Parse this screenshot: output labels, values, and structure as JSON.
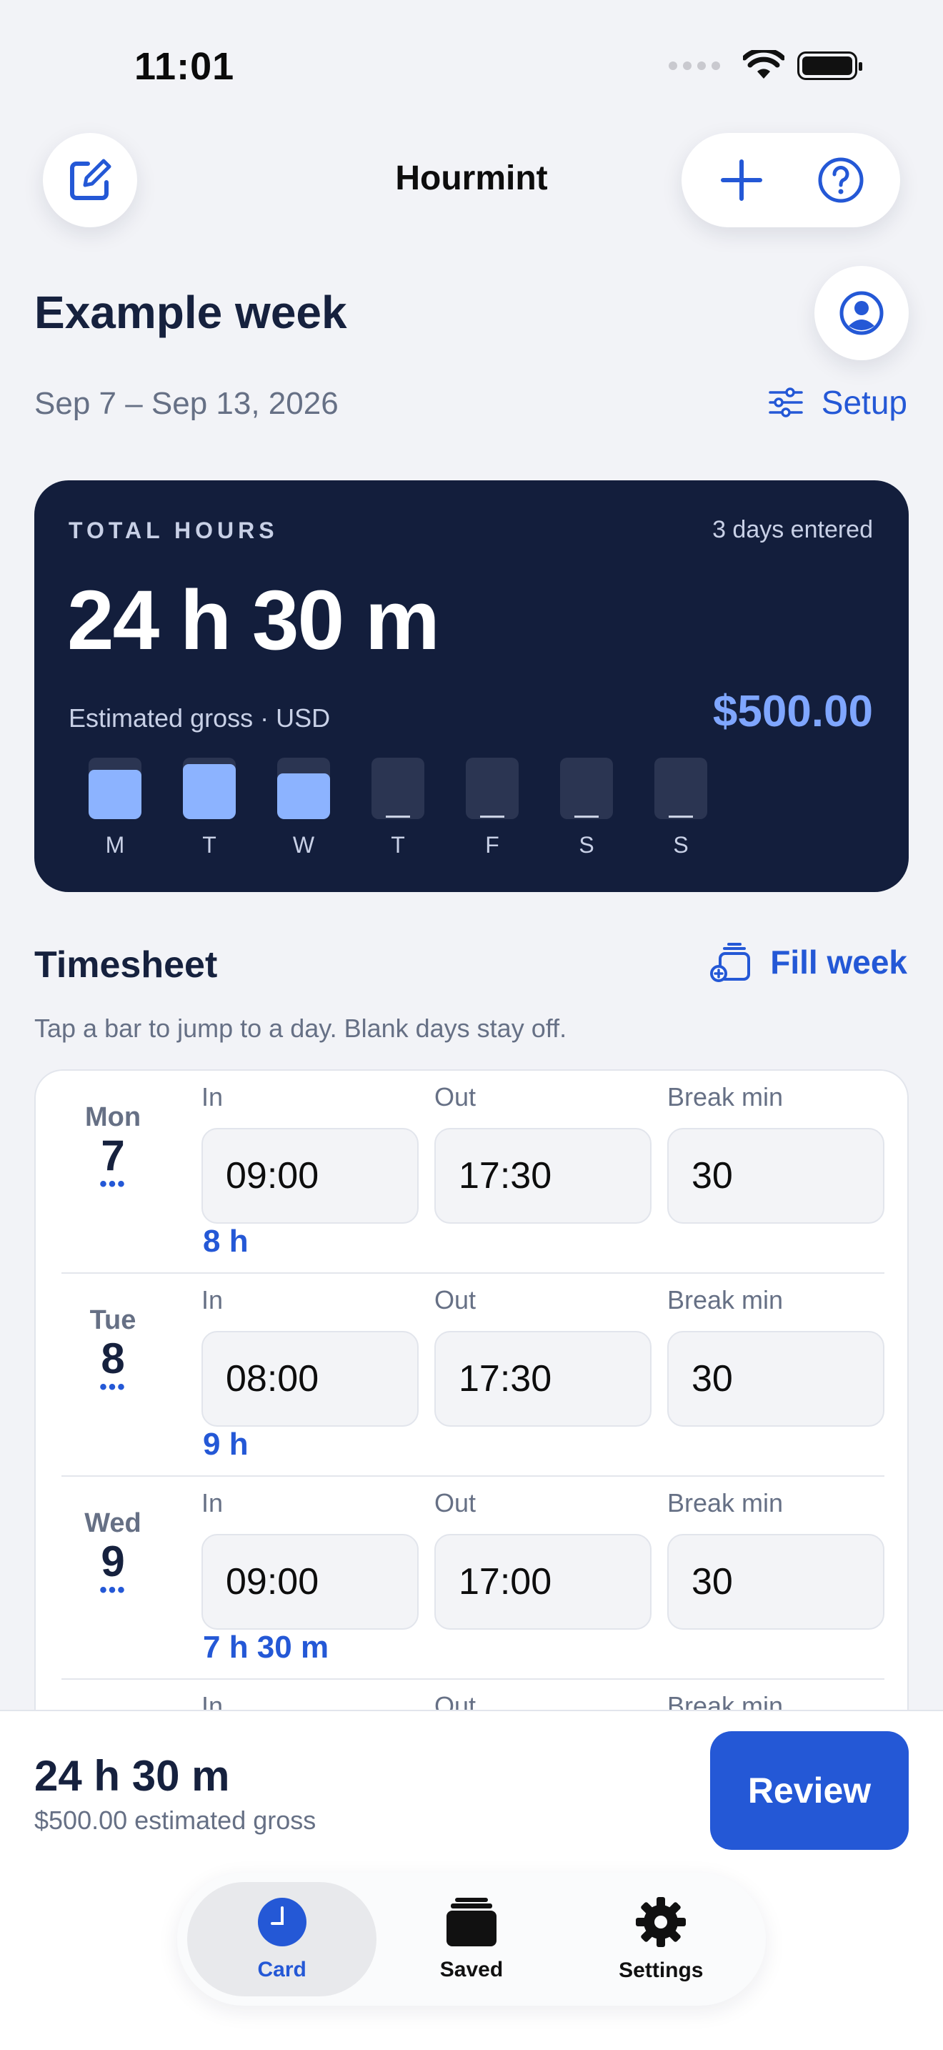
{
  "status_bar": {
    "time": "11:01"
  },
  "nav": {
    "title": "Hourmint",
    "compose_icon": "compose-icon",
    "add_icon": "plus-icon",
    "help_icon": "help-icon",
    "profile_icon": "profile-icon"
  },
  "header": {
    "title": "Example week",
    "date_range": "Sep 7 – Sep 13, 2026",
    "setup_label": "Setup"
  },
  "summary": {
    "label": "TOTAL HOURS",
    "days_entered": "3 days entered",
    "total": "24 h 30 m",
    "gross_label": "Estimated gross · USD",
    "gross_value": "$500.00",
    "days": [
      {
        "letter": "M",
        "fill": 0.8,
        "entered": true
      },
      {
        "letter": "T",
        "fill": 0.9,
        "entered": true
      },
      {
        "letter": "W",
        "fill": 0.75,
        "entered": true
      },
      {
        "letter": "T",
        "fill": 0,
        "entered": false,
        "empty_mark": "_"
      },
      {
        "letter": "F",
        "fill": 0,
        "entered": false,
        "empty_mark": "_"
      },
      {
        "letter": "S",
        "fill": 0,
        "entered": false,
        "empty_mark": "_"
      },
      {
        "letter": "S",
        "fill": 0,
        "entered": false,
        "empty_mark": "_"
      }
    ]
  },
  "timesheet": {
    "title": "Timesheet",
    "fill_week_label": "Fill week",
    "hint": "Tap a bar to jump to a day. Blank days stay off.",
    "labels": {
      "in": "In",
      "out": "Out",
      "break": "Break min"
    },
    "rows": [
      {
        "day": "Mon",
        "date": "7",
        "more": "•••",
        "in": "09:00",
        "out": "17:30",
        "break": "30",
        "total": "8 h"
      },
      {
        "day": "Tue",
        "date": "8",
        "more": "•••",
        "in": "08:00",
        "out": "17:30",
        "break": "30",
        "total": "9 h"
      },
      {
        "day": "Wed",
        "date": "9",
        "more": "•••",
        "in": "09:00",
        "out": "17:00",
        "break": "30",
        "total": "7 h 30 m"
      },
      {
        "day": "",
        "date": "",
        "more": "",
        "in": "",
        "out": "",
        "break": "",
        "total": ""
      }
    ]
  },
  "bottom": {
    "total": "24 h 30 m",
    "gross": "$500.00 estimated gross",
    "review_label": "Review"
  },
  "tabs": [
    {
      "label": "Card",
      "icon": "clock-icon",
      "active": true
    },
    {
      "label": "Saved",
      "icon": "stack-icon",
      "active": false
    },
    {
      "label": "Settings",
      "icon": "gear-icon",
      "active": false
    }
  ],
  "colors": {
    "accent": "#2458d6",
    "card": "#131e3c",
    "bar": "#8cb3ff"
  }
}
